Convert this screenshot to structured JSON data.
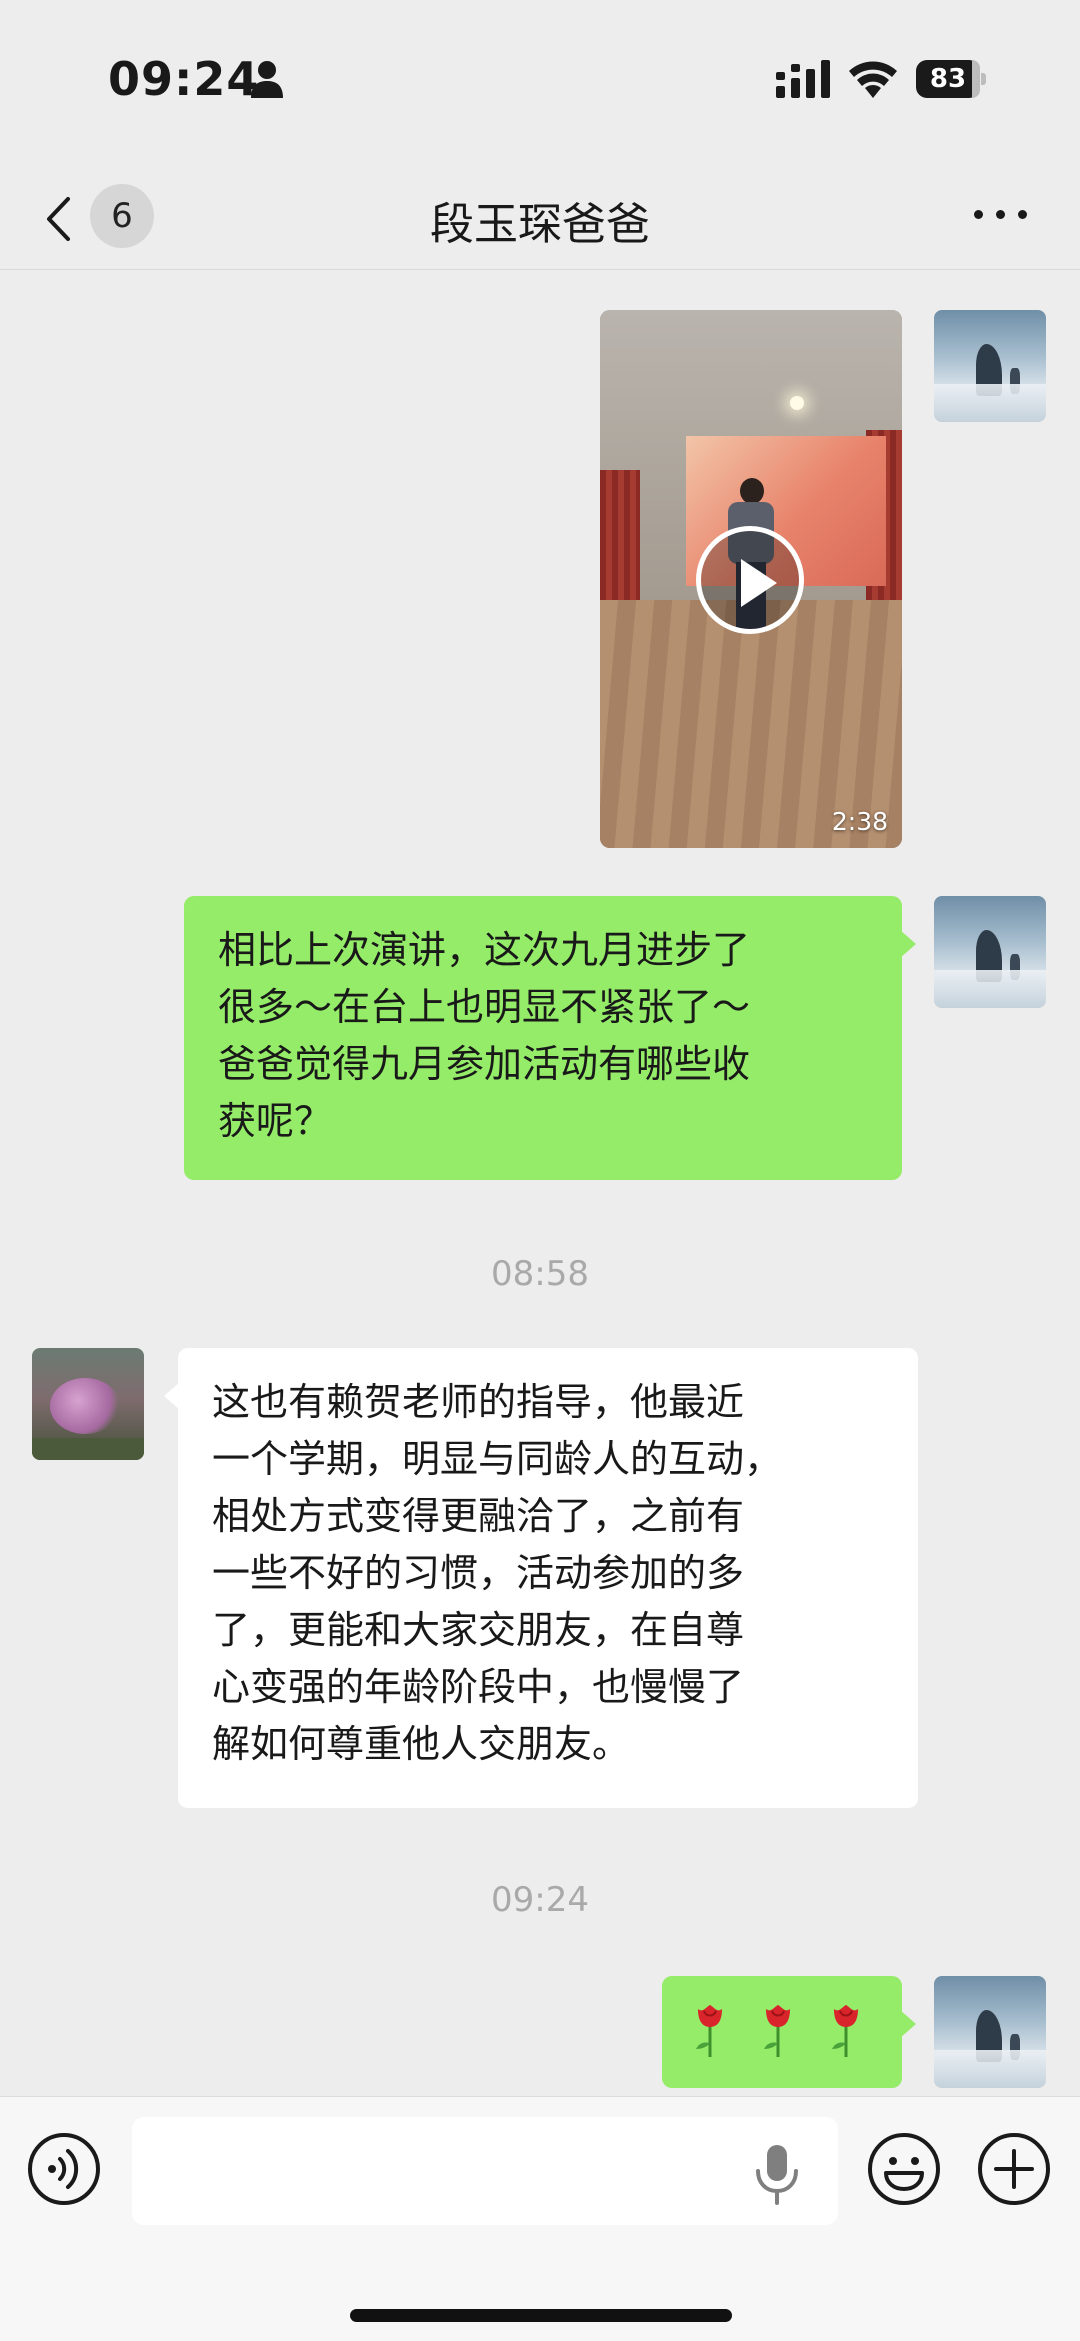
{
  "status_bar": {
    "time": "09:24",
    "battery": "83"
  },
  "nav": {
    "unread_count": "6",
    "title": "段玉琛爸爸"
  },
  "messages": [
    {
      "type": "video",
      "sender": "self",
      "duration": "2:38"
    },
    {
      "type": "text",
      "sender": "self",
      "lines": [
        "相比上次演讲，这次九月进步了",
        "很多～在台上也明显不紧张了～",
        "爸爸觉得九月参加活动有哪些收",
        "获呢？"
      ]
    },
    {
      "type": "timestamp",
      "text": "08:58"
    },
    {
      "type": "text",
      "sender": "other",
      "lines": [
        "这也有赖贺老师的指导，他最近",
        "一个学期，明显与同龄人的互动，",
        "相处方式变得更融洽了，之前有",
        "一些不好的习惯，活动参加的多",
        "了，更能和大家交朋友，在自尊",
        "心变强的年龄阶段中，也慢慢了",
        "解如何尊重他人交朋友。"
      ]
    },
    {
      "type": "timestamp",
      "text": "09:24"
    },
    {
      "type": "emoji",
      "sender": "self",
      "emoji": [
        "rose-icon",
        "rose-icon",
        "rose-icon"
      ]
    }
  ],
  "input": {
    "placeholder": ""
  },
  "colors": {
    "self_bubble": "#95ec69",
    "other_bubble": "#ffffff",
    "background": "#ededed"
  }
}
